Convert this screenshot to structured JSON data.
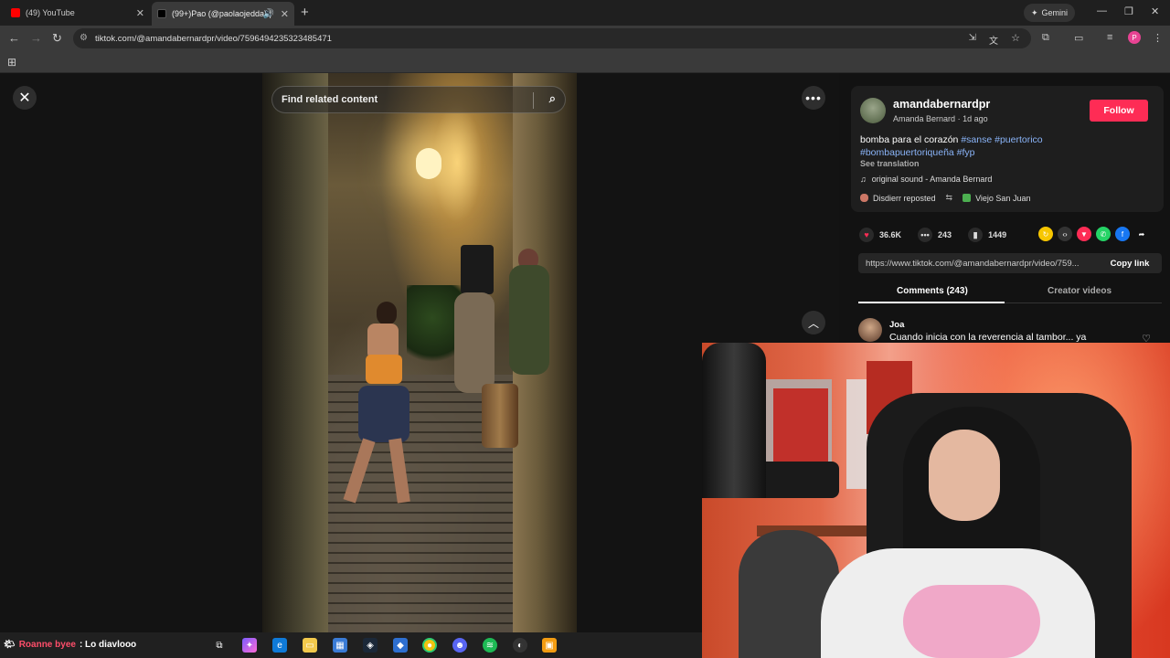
{
  "browser": {
    "tabs": [
      {
        "title": "(49) YouTube",
        "active": false
      },
      {
        "title": "(99+)Pao (@paolaojedda) |",
        "active": true
      }
    ],
    "gemini_label": "Gemini",
    "url": "tiktok.com/@amandabernardpr/video/7596494235323485471"
  },
  "video": {
    "search_placeholder": "Find related content"
  },
  "post": {
    "username": "amandabernardpr",
    "display_name": "Amanda Bernard",
    "time_ago": "1d ago",
    "follow_label": "Follow",
    "caption_text": "bomba para el corazón ",
    "hashtags_line1": "#sanse #puertorico",
    "hashtags_line2": "#bombapuertoriqueña #fyp",
    "see_translation": "See translation",
    "sound": "original sound - Amanda Bernard",
    "reposted_by": "Disdierr reposted",
    "location": "Viejo San Juan",
    "likes": "36.6K",
    "comments": "243",
    "saves": "1449",
    "share_link": "https://www.tiktok.com/@amandabernardpr/video/759...",
    "copy_link_label": "Copy link",
    "tab_comments": "Comments (243)",
    "tab_creator": "Creator videos",
    "first_comment": {
      "author": "Joa",
      "text": "Cuando inicia con la reverencia al tambor... ya"
    }
  },
  "taskbar": {
    "chat_user": "Roanne byee",
    "chat_message": ": Lo diavlooo"
  },
  "colors": {
    "follow": "#fe2c55",
    "hashtag": "#8ab4f8",
    "like": "#fe2c55"
  }
}
